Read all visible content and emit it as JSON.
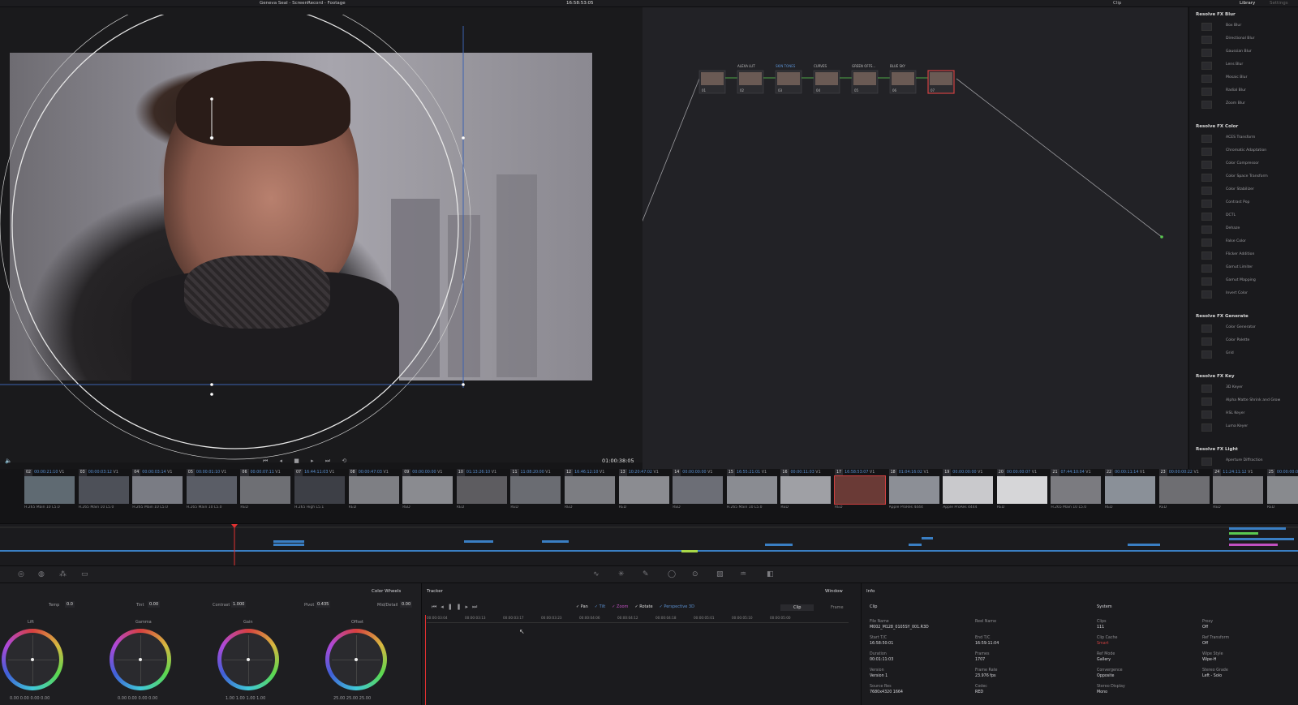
{
  "app": {
    "project_title": "Geneva Seal - ScreenRecord - Footage",
    "top_timecode": "16:58:53:05",
    "clip_mode": "Clip",
    "library_tab": "Library",
    "settings_tab": "Settings"
  },
  "viewer": {
    "timecode": "01:00:38:05",
    "transport_icons": "⏮ ◂ ■ ▸ ⏭ ⟲",
    "volume_icon": "🔈"
  },
  "node_labels": [
    "ALEXA LUT",
    "SKIN TONES",
    "CURVES",
    "GREEN OFFS...",
    "BLUE SKY"
  ],
  "node_numbers": [
    "01",
    "02",
    "03",
    "04",
    "05",
    "06",
    "07"
  ],
  "library": {
    "sections": [
      {
        "title": "Resolve FX Blur",
        "items": [
          "Box Blur",
          "Directional Blur",
          "Gaussian Blur",
          "Lens Blur",
          "Mosaic Blur",
          "Radial Blur",
          "Zoom Blur"
        ]
      },
      {
        "title": "Resolve FX Color",
        "items": [
          "ACES Transform",
          "Chromatic Adaptation",
          "Color Compressor",
          "Color Space Transform",
          "Color Stabilizer",
          "Contrast Pop",
          "DCTL",
          "Dehaze",
          "False Color",
          "Flicker Addition",
          "Gamut Limiter",
          "Gamut Mapping",
          "Invert Color"
        ]
      },
      {
        "title": "Resolve FX Generate",
        "items": [
          "Color Generator",
          "Color Palette",
          "Grid"
        ]
      },
      {
        "title": "Resolve FX Key",
        "items": [
          "3D Keyer",
          "Alpha Matte Shrink and Grow",
          "HSL Keyer",
          "Luma Keyer"
        ]
      },
      {
        "title": "Resolve FX Light",
        "items": [
          "Aperture Diffraction"
        ]
      }
    ]
  },
  "clips": [
    {
      "num": "02",
      "tc": "00:00:21:10",
      "track": "V1",
      "codec": "H.265 Main 10 L5.0"
    },
    {
      "num": "03",
      "tc": "00:00:03:12",
      "track": "V1",
      "codec": "H.265 Main 10 L5.0"
    },
    {
      "num": "04",
      "tc": "00:00:03:14",
      "track": "V1",
      "codec": "H.265 Main 10 L5.0"
    },
    {
      "num": "05",
      "tc": "00:00:01:10",
      "track": "V1",
      "codec": "H.265 Main 10 L5.0"
    },
    {
      "num": "06",
      "tc": "00:00:07:11",
      "track": "V1",
      "codec": "RED"
    },
    {
      "num": "07",
      "tc": "16:44:11:03",
      "track": "V1",
      "codec": "H.265 High L5.1"
    },
    {
      "num": "08",
      "tc": "00:00:47:03",
      "track": "V1",
      "codec": "RED"
    },
    {
      "num": "09",
      "tc": "00:00:00:00",
      "track": "V1",
      "codec": "RED"
    },
    {
      "num": "10",
      "tc": "01:13:26:10",
      "track": "V1",
      "codec": "RED"
    },
    {
      "num": "11",
      "tc": "11:08:20:00",
      "track": "V1",
      "codec": "RED"
    },
    {
      "num": "12",
      "tc": "16:46:12:10",
      "track": "V1",
      "codec": "RED"
    },
    {
      "num": "13",
      "tc": "10:20:47:02",
      "track": "V1",
      "codec": "RED"
    },
    {
      "num": "14",
      "tc": "00:00:00:00",
      "track": "V1",
      "codec": "RED"
    },
    {
      "num": "15",
      "tc": "16:55:21:01",
      "track": "V1",
      "codec": "H.265 Main 10 L5.0"
    },
    {
      "num": "16",
      "tc": "00:00:11:03",
      "track": "V1",
      "codec": "RED"
    },
    {
      "num": "17",
      "tc": "16:58:53:07",
      "track": "V1",
      "codec": "RED"
    },
    {
      "num": "18",
      "tc": "01:04:16:02",
      "track": "V1",
      "codec": "Apple ProRes 4444"
    },
    {
      "num": "19",
      "tc": "00:00:00:00",
      "track": "V1",
      "codec": "Apple ProRes 4444"
    },
    {
      "num": "20",
      "tc": "00:00:00:07",
      "track": "V1",
      "codec": "RED"
    },
    {
      "num": "21",
      "tc": "07:44:10:04",
      "track": "V1",
      "codec": "H.265 Main 10 L5.0"
    },
    {
      "num": "22",
      "tc": "00:00:11:14",
      "track": "V1",
      "codec": "RED"
    },
    {
      "num": "23",
      "tc": "00:00:00:22",
      "track": "V1",
      "codec": "RED"
    },
    {
      "num": "24",
      "tc": "11:24:11:12",
      "track": "V1",
      "codec": "RED"
    },
    {
      "num": "25",
      "tc": "00:00:00:00",
      "track": "V1",
      "codec": "RED"
    }
  ],
  "color_wheels": {
    "panel_title": "Color Wheels",
    "temp_label": "Temp",
    "temp_value": "0.0",
    "tint_label": "Tint",
    "tint_value": "0.00",
    "contrast_label": "Contrast",
    "contrast_value": "1.000",
    "pivot_label": "Pivot",
    "pivot_value": "0.435",
    "middetail_label": "Mid/Detail",
    "middetail_value": "0.00",
    "wheels": [
      {
        "label": "Lift",
        "values": "0.00   0.00   0.00   0.00"
      },
      {
        "label": "Gamma",
        "values": "0.00   0.00   0.00   0.00"
      },
      {
        "label": "Gain",
        "values": "1.00   1.00   1.00   1.00"
      },
      {
        "label": "Offset",
        "values": "25.00   25.00   25.00"
      }
    ]
  },
  "tracker": {
    "title": "Tracker",
    "options": [
      "Pan",
      "Tilt",
      "Zoom",
      "Rotate",
      "Perspective 3D"
    ],
    "clip_tab": "Clip",
    "frame_tab": "Frame",
    "window_label": "Window",
    "ruler": [
      "00:00:03:04",
      "00:00:03:13",
      "00:00:03:17",
      "00:00:03:23",
      "00:00:04:06",
      "00:00:04:12",
      "00:00:04:18",
      "00:00:05:01",
      "00:00:05:10",
      "00:00:05:00"
    ]
  },
  "info": {
    "title": "Info",
    "clip_header": "Clip",
    "system_header": "System",
    "fields": [
      {
        "k": "File Name",
        "v": "M002_M128_0105SY_001.R3D"
      },
      {
        "k": "Start T/C",
        "v": "16:58:50:01"
      },
      {
        "k": "Duration",
        "v": "00:01:11:03"
      },
      {
        "k": "Version",
        "v": "Version 1"
      },
      {
        "k": "Source Res",
        "v": "7680x4320 1664"
      }
    ],
    "fields2": [
      {
        "k": "Reel Name",
        "v": ""
      },
      {
        "k": "End T/C",
        "v": "16:59:11:04"
      },
      {
        "k": "Frames",
        "v": "1707"
      },
      {
        "k": "Frame Rate",
        "v": "23.976 fps"
      },
      {
        "k": "Codec",
        "v": "RED"
      }
    ],
    "sys1": [
      {
        "k": "Clips",
        "v": "111"
      },
      {
        "k": "Clip Cache",
        "v": "Smart"
      },
      {
        "k": "Ref Mode",
        "v": "Gallery"
      },
      {
        "k": "Convergence",
        "v": "Opposite"
      },
      {
        "k": "Stereo Display",
        "v": "Mono"
      }
    ],
    "sys2": [
      {
        "k": "Proxy",
        "v": "Off"
      },
      {
        "k": "Ref Transform",
        "v": "Off"
      },
      {
        "k": "Wipe Style",
        "v": "Wipe-H"
      },
      {
        "k": "Stereo Grade",
        "v": "Left - Solo"
      }
    ]
  },
  "colors": {
    "accent": "#d99c3b",
    "playhead": "#e03030",
    "timecode_blue": "#5a8fcf",
    "clip_bar": "#3a7fc4"
  }
}
